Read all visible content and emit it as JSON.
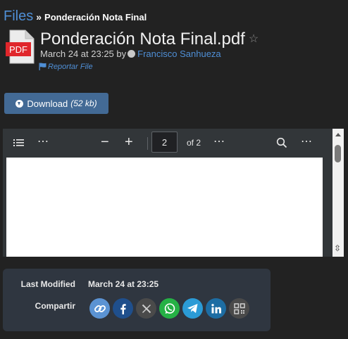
{
  "breadcrumb": {
    "root": "Files",
    "separator": "»",
    "current": "Ponderación Nota Final"
  },
  "file": {
    "icon_label": "PDF",
    "title": "Ponderación Nota Final.pdf",
    "favorite_icon": "star-outline-icon",
    "date": "March 24 at 23:25",
    "by": "by",
    "author": "Francisco Sanhueza",
    "report_label": "Reportar File"
  },
  "download": {
    "label": "Download",
    "size": "(52 kb)"
  },
  "viewer": {
    "current_page": "2",
    "page_of": "of 2",
    "toolbar_icons": [
      "outline-icon",
      "more-horizontal-icon",
      "zoom-out-icon",
      "zoom-in-icon",
      "more-horizontal-icon",
      "search-icon",
      "more-vertical-icon"
    ]
  },
  "details": {
    "last_modified_label": "Last Modified",
    "last_modified_value": "March 24 at 23:25",
    "share_label": "Compartir"
  },
  "share_links": [
    {
      "name": "copy-link-icon",
      "color": "#5b93d3"
    },
    {
      "name": "facebook-icon",
      "color": "#1f4f8c"
    },
    {
      "name": "x-twitter-icon",
      "color": "#4a4a4a"
    },
    {
      "name": "whatsapp-icon",
      "color": "#25b145"
    },
    {
      "name": "telegram-icon",
      "color": "#2b9bd6"
    },
    {
      "name": "linkedin-icon",
      "color": "#1d6da3"
    },
    {
      "name": "qr-code-icon",
      "color": "#4a4a4a"
    }
  ],
  "colors": {
    "background": "#222222",
    "link": "#4f8fd6",
    "download_button": "#436a95",
    "pdf_red": "#e0262b"
  }
}
